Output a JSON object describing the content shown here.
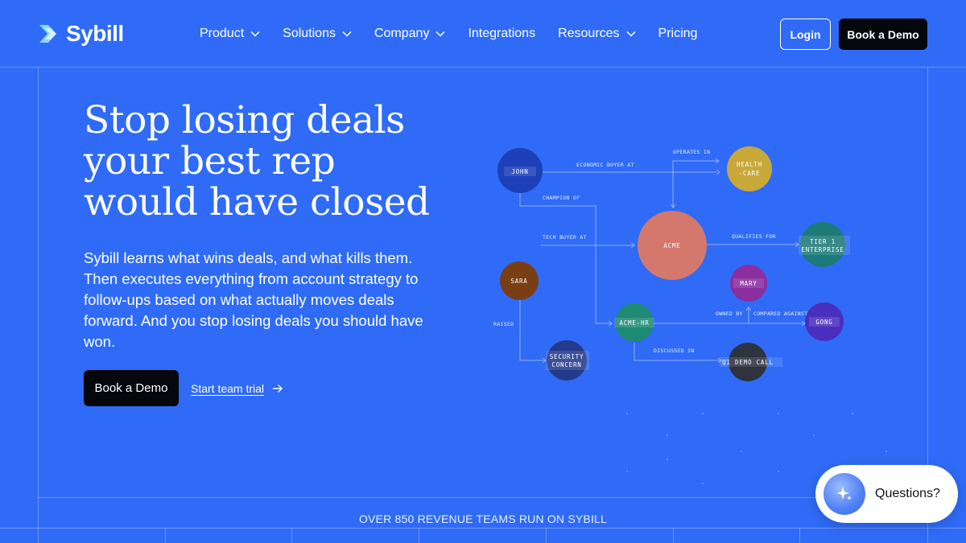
{
  "brand": {
    "name": "Sybill"
  },
  "nav": {
    "items": [
      {
        "label": "Product",
        "dropdown": true
      },
      {
        "label": "Solutions",
        "dropdown": true
      },
      {
        "label": "Company",
        "dropdown": true
      },
      {
        "label": "Integrations",
        "dropdown": false
      },
      {
        "label": "Resources",
        "dropdown": true
      },
      {
        "label": "Pricing",
        "dropdown": false
      }
    ],
    "login_label": "Login",
    "demo_label": "Book a Demo"
  },
  "hero": {
    "title_lines": [
      "Stop losing deals",
      "your best rep",
      "would have closed"
    ],
    "subtitle": "Sybill learns what wins deals, and what kills them. Then executes everything from account strategy to follow-ups based on what actually moves deals forward. And you stop losing deals you should have won.",
    "primary_cta": "Book a Demo",
    "secondary_cta": "Start team trial"
  },
  "graph": {
    "nodes": {
      "john": "JOHN",
      "health": [
        "HEALTH",
        "-CARE"
      ],
      "acme": "ACME",
      "tier": [
        "TIER 1",
        "ENTERPRISE"
      ],
      "sara": "SARA",
      "mary": "MARY",
      "acmehr": "ACME-HR",
      "gong": "GONG",
      "security": [
        "SECURITY",
        "CONCERN"
      ],
      "demo": "Q1 DEMO CALL"
    },
    "edges": {
      "economic_buyer": "ECONOMIC BUYER AT",
      "operates_in": "OPERATES IN",
      "champion_of": "CHAMPION OF",
      "tech_buyer": "TECH BUYER AT",
      "qualifies_for": "QUALIFIES FOR",
      "raised": "RAISED",
      "owned_by": "OWNED BY",
      "compared_against": "COMPARED AGAINST",
      "discussed_in": "DISCUSSED IN"
    }
  },
  "banner": {
    "text": "OVER 850 REVENUE TEAMS RUN ON SYBILL"
  },
  "chat": {
    "label": "Questions?"
  },
  "colors": {
    "background": "#2f6bf6",
    "john": "#1d3fb8",
    "health": "#c9a83a",
    "acme": "#d4786e",
    "tier": "#1c7a78",
    "sara": "#7a3e14",
    "mary": "#8a2ea0",
    "acmehr": "#1f8a73",
    "gong": "#4a2fbf",
    "security": "#243a8a",
    "demo": "#2e3340"
  }
}
